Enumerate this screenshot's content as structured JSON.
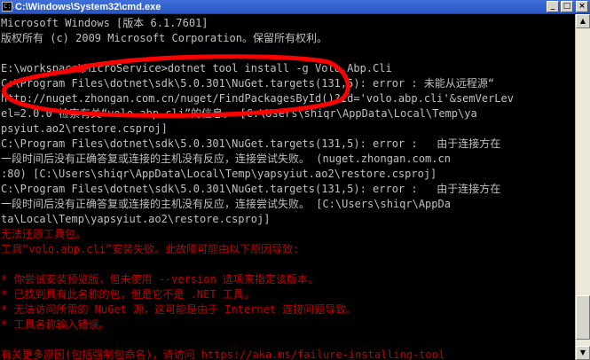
{
  "window": {
    "title": "C:\\Windows\\System32\\cmd.exe",
    "icon": "console-icon",
    "controls": {
      "minimize": "_",
      "maximize": "□",
      "close": "×"
    }
  },
  "console": {
    "lines": [
      {
        "text": "Microsoft Windows [版本 6.1.7601]",
        "color": "#c0c0c0"
      },
      {
        "text": "版权所有 (c) 2009 Microsoft Corporation。保留所有权利。",
        "color": "#c0c0c0"
      },
      {
        "text": "",
        "color": "#c0c0c0"
      },
      {
        "text": "E:\\workspace\\MicroService>dotnet tool install -g Volo.Abp.Cli",
        "color": "#c0c0c0"
      },
      {
        "text": "C:\\Program Files\\dotnet\\sdk\\5.0.301\\NuGet.targets(131,5): error : 未能从远程源“",
        "color": "#c0c0c0"
      },
      {
        "text": "http://nuget.zhongan.com.cn/nuget/FindPackagesById()?id='volo.abp.cli'&semVerLev",
        "color": "#c0c0c0"
      },
      {
        "text": "el=2.0.0”检索有关“volo.abp.cli”的信息。 [C:\\Users\\shiqr\\AppData\\Local\\Temp\\ya",
        "color": "#c0c0c0"
      },
      {
        "text": "psyiut.ao2\\restore.csproj]",
        "color": "#c0c0c0"
      },
      {
        "text": "C:\\Program Files\\dotnet\\sdk\\5.0.301\\NuGet.targets(131,5): error :   由于连接方在",
        "color": "#c0c0c0"
      },
      {
        "text": "一段时间后没有正确答复或连接的主机没有反应，连接尝试失败。 (nuget.zhongan.com.cn",
        "color": "#c0c0c0"
      },
      {
        "text": ":80) [C:\\Users\\shiqr\\AppData\\Local\\Temp\\yapsyiut.ao2\\restore.csproj]",
        "color": "#c0c0c0"
      },
      {
        "text": "C:\\Program Files\\dotnet\\sdk\\5.0.301\\NuGet.targets(131,5): error :   由于连接方在",
        "color": "#c0c0c0"
      },
      {
        "text": "一段时间后没有正确答复或连接的主机没有反应，连接尝试失败。 [C:\\Users\\shiqr\\AppDa",
        "color": "#c0c0c0"
      },
      {
        "text": "ta\\Local\\Temp\\yapsyiut.ao2\\restore.csproj]",
        "color": "#c0c0c0"
      },
      {
        "text": "无法还原工具包。",
        "color": "#c00000"
      },
      {
        "text": "工具“volo.abp.cli”安装失败。此故障可能由以下原因导致:",
        "color": "#c00000"
      },
      {
        "text": "",
        "color": "#c00000"
      },
      {
        "text": "* 你尝试安装预览版，但未使用 --version 选项来指定该版本。",
        "color": "#c00000"
      },
      {
        "text": "* 已找到具有此名称的包，但是它不是 .NET 工具。",
        "color": "#c00000"
      },
      {
        "text": "* 无法访问所需的 NuGet 源，这可能是由于 Internet 连接问题导致。",
        "color": "#c00000"
      },
      {
        "text": "* 工具名称输入错误。",
        "color": "#c00000"
      },
      {
        "text": "",
        "color": "#c00000"
      },
      {
        "text": "有关更多原因(包括强制包命名)，请访问 https://aka.ms/failure-installing-tool",
        "color": "#c00000"
      }
    ]
  },
  "colors": {
    "background": "#000000",
    "text": "#c0c0c0",
    "error": "#c00000",
    "annotation": "#ff0000"
  }
}
